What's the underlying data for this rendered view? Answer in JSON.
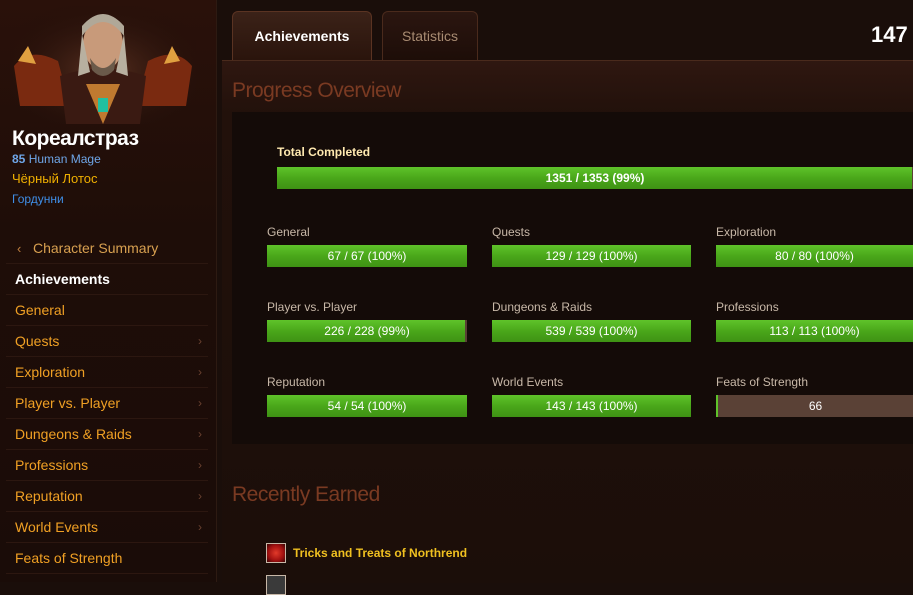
{
  "character": {
    "name": "Кореалстраз",
    "level": "85",
    "race_class": "Human Mage",
    "guild": "Чёрный Лотос",
    "realm": "Гордунни"
  },
  "sidebar": {
    "back_label": "Character Summary",
    "current_label": "Achievements",
    "items": [
      {
        "label": "General"
      },
      {
        "label": "Quests"
      },
      {
        "label": "Exploration"
      },
      {
        "label": "Player vs. Player"
      },
      {
        "label": "Dungeons & Raids"
      },
      {
        "label": "Professions"
      },
      {
        "label": "Reputation"
      },
      {
        "label": "World Events"
      },
      {
        "label": "Feats of Strength"
      }
    ]
  },
  "tabs": {
    "achievements": "Achievements",
    "statistics": "Statistics"
  },
  "points": "147",
  "progress_overview": {
    "title": "Progress Overview",
    "total": {
      "label": "Total Completed",
      "text": "1351 / 1353 (99%)",
      "fraction": 0.9985
    },
    "categories": [
      {
        "label": "General",
        "text": "67 / 67 (100%)",
        "fraction": 1.0
      },
      {
        "label": "Quests",
        "text": "129 / 129 (100%)",
        "fraction": 1.0
      },
      {
        "label": "Exploration",
        "text": "80 / 80 (100%)",
        "fraction": 1.0
      },
      {
        "label": "Player vs. Player",
        "text": "226 / 228 (99%)",
        "fraction": 0.991
      },
      {
        "label": "Dungeons & Raids",
        "text": "539 / 539 (100%)",
        "fraction": 1.0
      },
      {
        "label": "Professions",
        "text": "113 / 113 (100%)",
        "fraction": 1.0
      },
      {
        "label": "Reputation",
        "text": "54 / 54 (100%)",
        "fraction": 1.0
      },
      {
        "label": "World Events",
        "text": "143 / 143 (100%)",
        "fraction": 1.0
      },
      {
        "label": "Feats of Strength",
        "text": "66",
        "fraction": 0.0
      }
    ]
  },
  "recently_earned": {
    "title": "Recently Earned",
    "items": [
      {
        "name": "Tricks and Treats of Northrend",
        "icon": "candy-apple-icon"
      }
    ]
  },
  "colors": {
    "accent_orange": "#f0a024",
    "bar_green": "#4aa71a",
    "bar_empty": "#5a4135",
    "section_title": "#7a3a22",
    "guild_gold": "#f0b000",
    "class_blue": "#6fa6e8"
  }
}
